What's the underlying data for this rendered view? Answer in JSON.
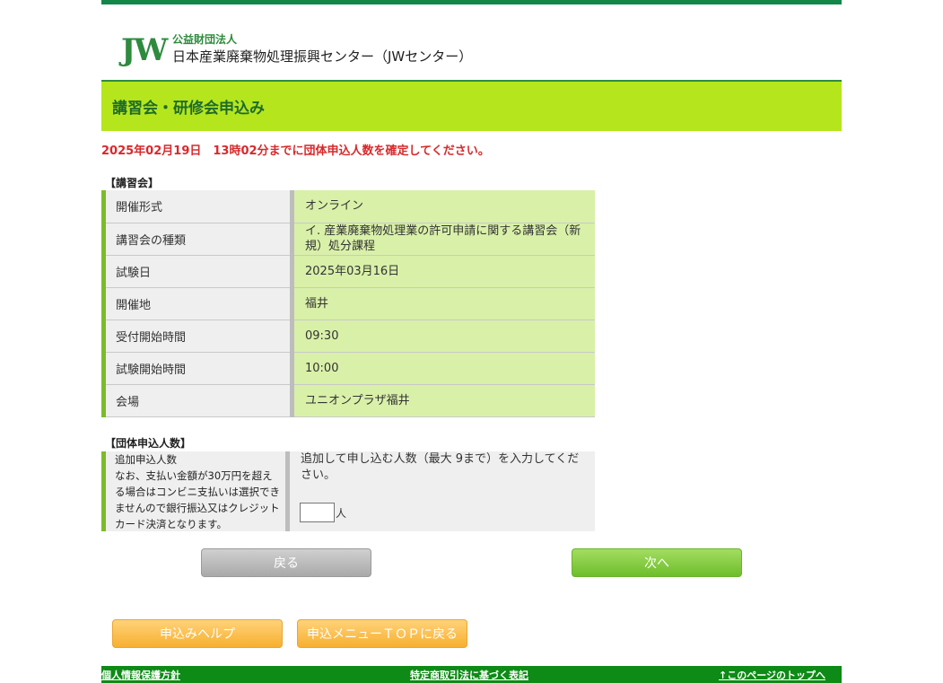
{
  "header": {
    "logo_mark": "JW",
    "org_type": "公益財団法人",
    "org_name": "日本産業廃棄物処理振興センター（JWセンター）"
  },
  "page": {
    "title": "講習会・研修会申込み",
    "deadline": "2025年02月19日　13時02分までに団体申込人数を確定してください。"
  },
  "course": {
    "section_label": "【講習会】",
    "rows": [
      {
        "label": "開催形式",
        "value": "オンライン"
      },
      {
        "label": "講習会の種類",
        "value": "イ. 産業廃棄物処理業の許可申請に関する講習会（新規）処分課程"
      },
      {
        "label": "試験日",
        "value": "2025年03月16日"
      },
      {
        "label": "開催地",
        "value": "福井"
      },
      {
        "label": "受付開始時間",
        "value": "09:30"
      },
      {
        "label": "試験開始時間",
        "value": "10:00"
      },
      {
        "label": "会場",
        "value": "ユニオンプラザ福井"
      }
    ]
  },
  "group": {
    "section_label": "【団体申込人数】",
    "label_title": "追加申込人数",
    "label_note": "なお、支払い金額が30万円を超える場合はコンビニ支払いは選択できませんので銀行振込又はクレジットカード決済となります。",
    "instruction": "追加して申し込む人数（最大 9まで）を入力してください。",
    "input_value": "",
    "unit": "人"
  },
  "buttons": {
    "back": "戻る",
    "next": "次へ",
    "help": "申込みヘルプ",
    "menu_top": "申込メニューＴＯＰに戻る"
  },
  "footer": {
    "privacy": "個人情報保護方針",
    "commerce": "特定商取引法に基づく表記",
    "page_top": "↑このページのトップへ"
  },
  "colors": {
    "brand_green": "#12874a",
    "title_bar": "#b5e61d",
    "deadline_red": "#d8292c",
    "value_cell": "#d9f0a9",
    "footer_green": "#0e8a16"
  }
}
